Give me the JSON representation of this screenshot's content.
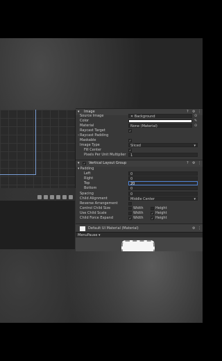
{
  "inspector": {
    "image_component": {
      "title": "Image",
      "source_image_label": "Source Image",
      "source_image_value": "Background",
      "color_label": "Color",
      "color_value": "#ffffff",
      "material_label": "Material",
      "material_value": "None (Material)",
      "raycast_target_label": "Raycast Target",
      "raycast_target_checked": true,
      "raycast_padding_label": "Raycast Padding",
      "maskable_label": "Maskable",
      "maskable_checked": true,
      "image_type_label": "Image Type",
      "image_type_value": "Sliced",
      "fill_center_label": "Fill Center",
      "fill_center_checked": true,
      "ppu_label": "Pixels Per Unit Multiplier",
      "ppu_value": "1"
    },
    "vertical_layout_group": {
      "title": "Vertical Layout Group",
      "padding_label": "Padding",
      "left_label": "Left",
      "left_value": "0",
      "right_label": "Right",
      "right_value": "0",
      "top_label": "Top",
      "top_value": "20",
      "bottom_label": "Bottom",
      "bottom_value": "0",
      "spacing_label": "Spacing",
      "spacing_value": "0",
      "child_alignment_label": "Child Alignment",
      "child_alignment_value": "Middle Center",
      "reverse_arrangement_label": "Reverse Arrangement",
      "control_child_size_label": "Control Child Size",
      "use_child_scale_label": "Use Child Scale",
      "child_force_expand_label": "Child Force Expand",
      "width_label": "Width",
      "height_label": "Height",
      "control_child_size": {
        "width": false,
        "height": false
      },
      "use_child_scale": {
        "width": false,
        "height": true
      },
      "child_force_expand": {
        "width": true,
        "height": true
      }
    },
    "material_row": {
      "label": "Default UI Material (Material)"
    },
    "preview_bar": {
      "label": "MenuPause ▾"
    }
  },
  "icons": {
    "checkmark": "✓",
    "foldout": "▾",
    "target": "⊙",
    "dropdown": "▾"
  }
}
